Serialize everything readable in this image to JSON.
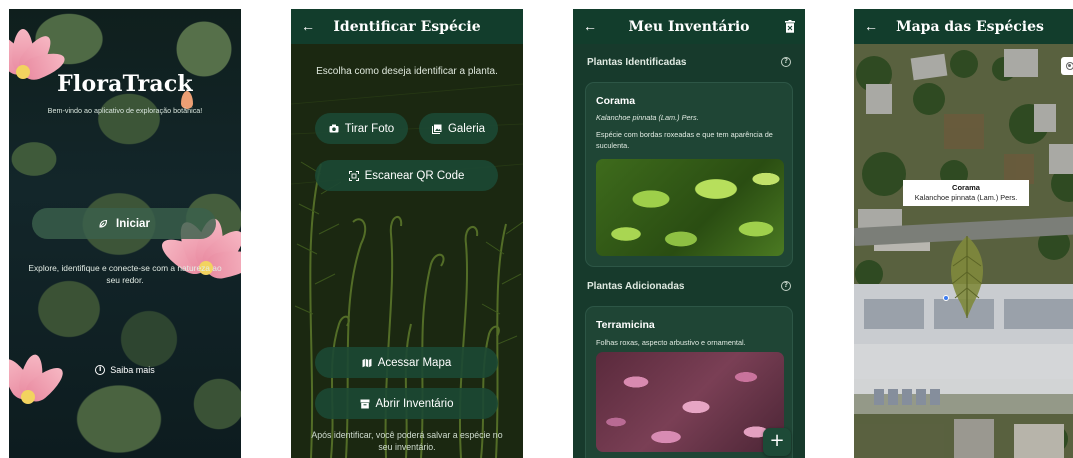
{
  "screen1": {
    "app_title": "FloraTrack",
    "subtitle": "Bem-vindo ao aplicativo de exploração botânica!",
    "start_button": "Iniciar",
    "description": "Explore, identifique e conecte-se com a natureza ao seu redor.",
    "learn_more": "Saiba mais"
  },
  "screen2": {
    "title": "Identificar Espécie",
    "prompt": "Escolha como deseja identificar a planta.",
    "take_photo": "Tirar Foto",
    "gallery": "Galeria",
    "scan_qr": "Escanear QR Code",
    "open_map": "Acessar Mapa",
    "open_inventory": "Abrir Inventário",
    "footer_note": "Após identificar, você poderá salvar a espécie no seu inventário."
  },
  "screen3": {
    "title": "Meu Inventário",
    "identified_header": "Plantas Identificadas",
    "added_header": "Plantas Adicionadas",
    "cards": [
      {
        "name": "Corama",
        "scientific": "Kalanchoe pinnata (Lam.) Pers.",
        "description": "Espécie com bordas roxeadas e que tem aparência de suculenta."
      },
      {
        "name": "Terramicina",
        "description": "Folhas roxas, aspecto arbustivo e ornamental."
      }
    ],
    "fab_label": "+"
  },
  "screen4": {
    "title": "Mapa das Espécies",
    "marker_name": "Corama",
    "marker_scientific": "Kalanchoe pinnata (Lam.) Pers."
  },
  "common": {
    "back_glyph": "←"
  },
  "colors": {
    "app_bar": "#123d2c",
    "button": "#1c4834",
    "card": "#1f4535",
    "location_dot": "#3d7cf0"
  },
  "icons": [
    "back-arrow-icon",
    "leaf-icon",
    "camera-icon",
    "gallery-icon",
    "qr-scan-icon",
    "map-icon",
    "inventory-icon",
    "info-icon",
    "trash-icon",
    "plus-icon",
    "location-target-icon",
    "leaf-marker-icon"
  ]
}
